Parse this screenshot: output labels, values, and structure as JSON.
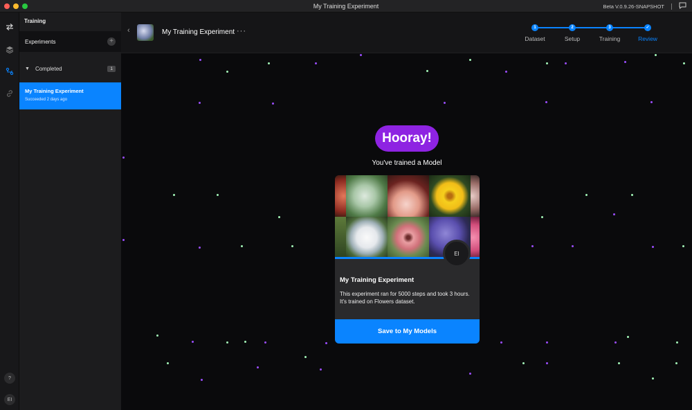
{
  "window": {
    "title": "My Training Experiment",
    "version": "Beta V.0.9.26-SNAPSHOT",
    "traffic_colors": [
      "#ff5f57",
      "#febc2e",
      "#28c840"
    ]
  },
  "rail": {
    "icons": [
      "swap-icon",
      "layers-icon",
      "training-icon",
      "link-icon"
    ],
    "help_label": "?",
    "user_initials": "EI"
  },
  "sidebar": {
    "title": "Training",
    "experiments_label": "Experiments",
    "add_label": "+",
    "group_label": "Completed",
    "group_count": "1",
    "items": [
      {
        "name": "My Training Experiment",
        "status": "Succeeded 2 days ago"
      }
    ]
  },
  "header": {
    "experiment_name": "My Training Experiment",
    "more_label": "···",
    "back_label": "‹",
    "steps": [
      {
        "num": "1",
        "label": "Dataset"
      },
      {
        "num": "2",
        "label": "Setup"
      },
      {
        "num": "3",
        "label": "Training"
      },
      {
        "num": "✓",
        "label": "Review"
      }
    ],
    "active_step": 3
  },
  "celebration": {
    "badge": "Hooray!",
    "subtitle": "You've trained a Model",
    "accent": "#8e23e2",
    "confetti_colors": [
      "#a3f5b8",
      "#9b4dff"
    ]
  },
  "card": {
    "title": "My Training Experiment",
    "description": "This experiment ran for 5000 steps and took 3 hours. It's trained on Flowers dataset.",
    "avatar_initials": "EI",
    "button_label": "Save to My Models",
    "accent": "#0a84ff"
  }
}
